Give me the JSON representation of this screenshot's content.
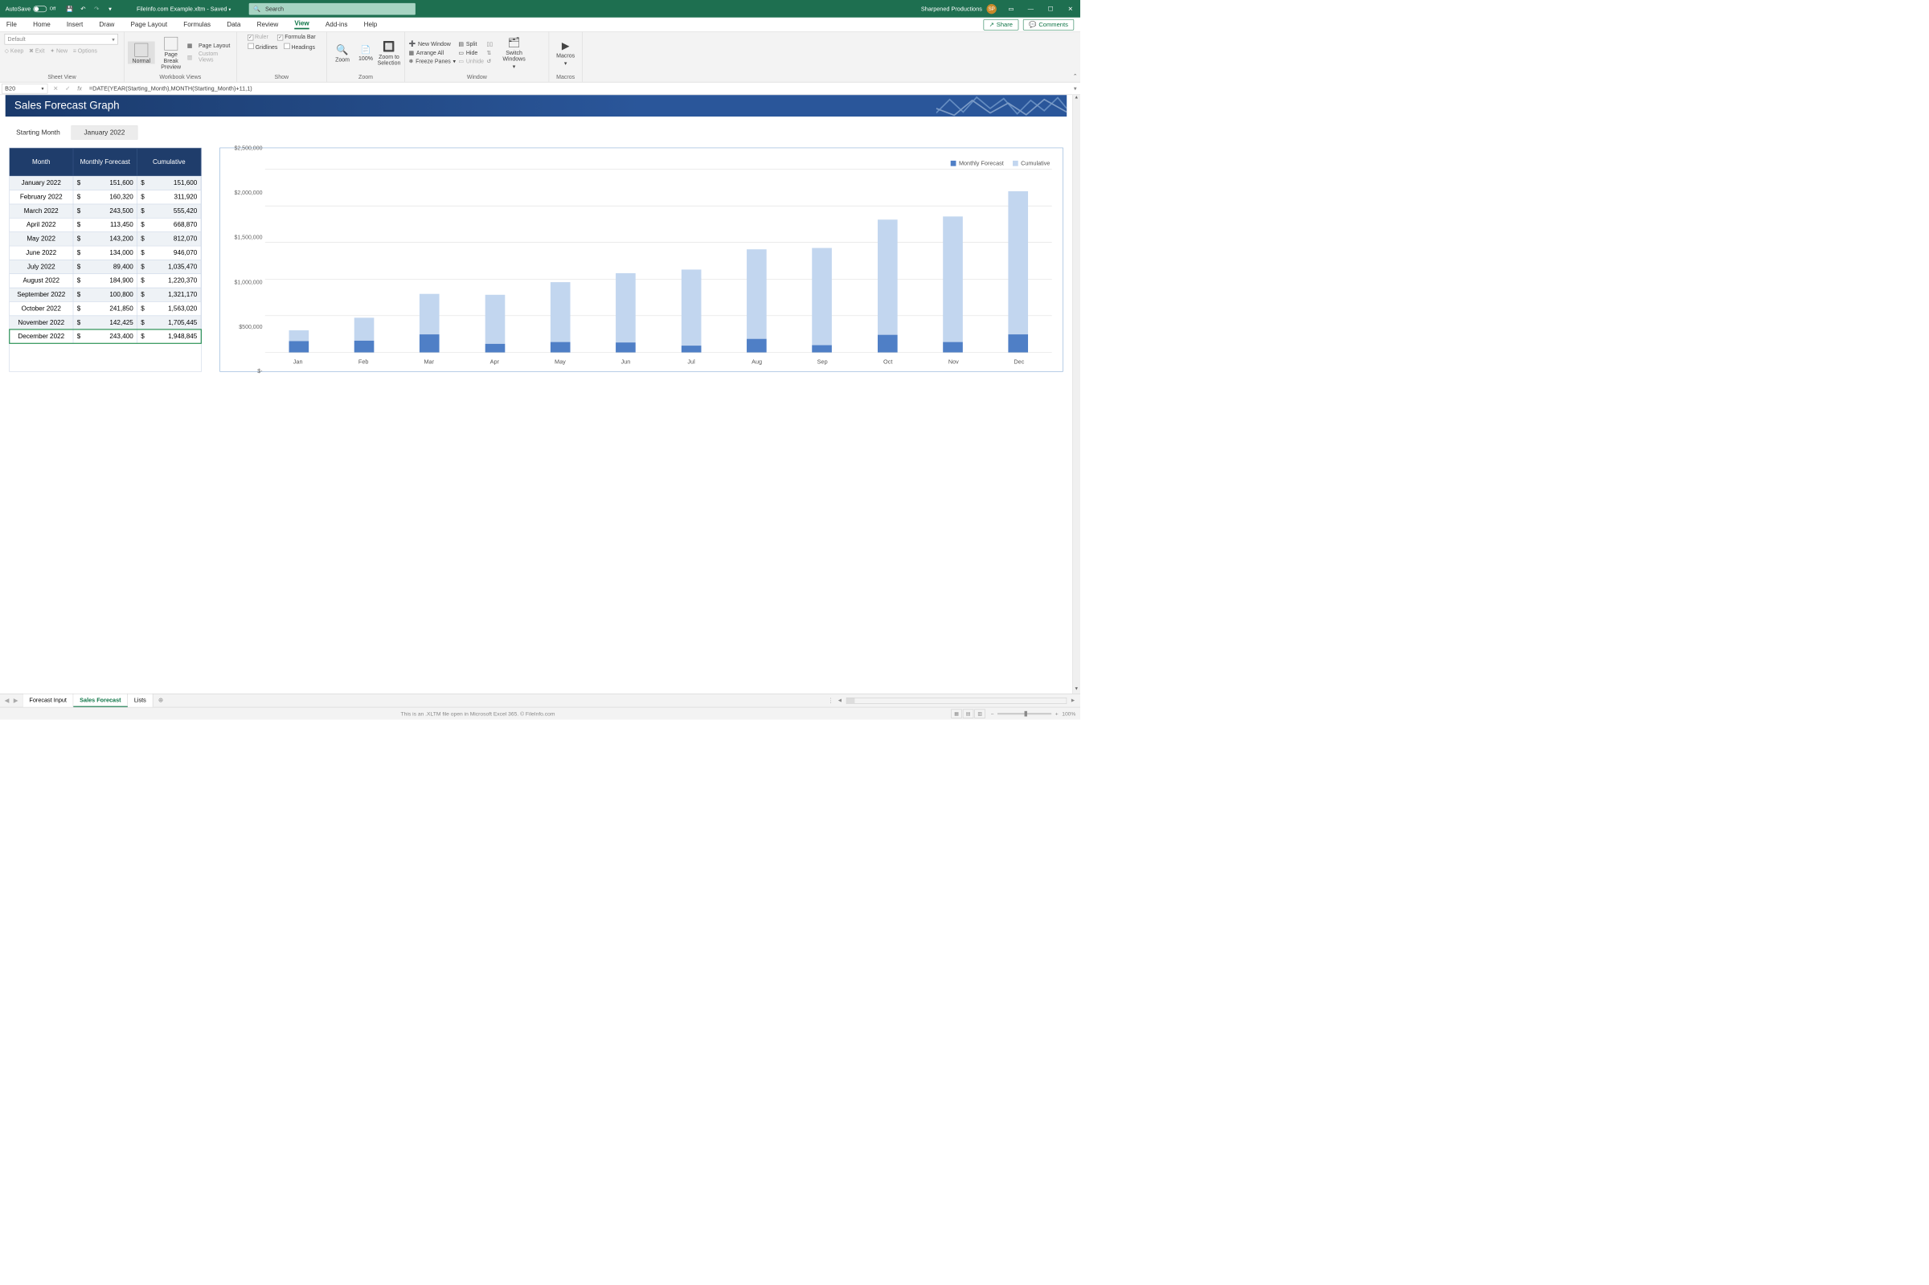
{
  "titlebar": {
    "autosave_label": "AutoSave",
    "autosave_state": "Off",
    "doc_title": "FileInfo.com Example.xltm - Saved",
    "search_placeholder": "Search",
    "account": "Sharpened Productions",
    "account_initials": "SP"
  },
  "ribbon_tabs": [
    "File",
    "Home",
    "Insert",
    "Draw",
    "Page Layout",
    "Formulas",
    "Data",
    "Review",
    "View",
    "Add-ins",
    "Help"
  ],
  "active_tab": "View",
  "share_label": "Share",
  "comments_label": "Comments",
  "ribbon": {
    "sheet_view": {
      "default": "Default",
      "keep": "Keep",
      "exit": "Exit",
      "new": "New",
      "options": "Options",
      "label": "Sheet View"
    },
    "workbook_views": {
      "normal": "Normal",
      "page_break": "Page Break Preview",
      "page_layout": "Page Layout",
      "custom": "Custom Views",
      "label": "Workbook Views"
    },
    "show": {
      "ruler": "Ruler",
      "formula_bar": "Formula Bar",
      "gridlines": "Gridlines",
      "headings": "Headings",
      "label": "Show"
    },
    "zoom": {
      "zoom": "Zoom",
      "hundred": "100%",
      "to_selection": "Zoom to Selection",
      "label": "Zoom"
    },
    "window": {
      "new_window": "New Window",
      "arrange_all": "Arrange All",
      "freeze": "Freeze Panes",
      "split": "Split",
      "hide": "Hide",
      "unhide": "Unhide",
      "switch": "Switch Windows",
      "label": "Window"
    },
    "macros": {
      "macros": "Macros",
      "label": "Macros"
    }
  },
  "formula_bar": {
    "cell_ref": "B20",
    "formula": "=DATE(YEAR(Starting_Month),MONTH(Starting_Month)+11,1)"
  },
  "banner_title": "Sales Forecast Graph",
  "starting_month": {
    "label": "Starting Month",
    "value": "January 2022"
  },
  "table": {
    "headers": [
      "Month",
      "Monthly Forecast",
      "Cumulative"
    ],
    "rows": [
      {
        "month": "January 2022",
        "forecast": "151,600",
        "cumulative": "151,600"
      },
      {
        "month": "February 2022",
        "forecast": "160,320",
        "cumulative": "311,920"
      },
      {
        "month": "March 2022",
        "forecast": "243,500",
        "cumulative": "555,420"
      },
      {
        "month": "April 2022",
        "forecast": "113,450",
        "cumulative": "668,870"
      },
      {
        "month": "May 2022",
        "forecast": "143,200",
        "cumulative": "812,070"
      },
      {
        "month": "June 2022",
        "forecast": "134,000",
        "cumulative": "946,070"
      },
      {
        "month": "July 2022",
        "forecast": "89,400",
        "cumulative": "1,035,470"
      },
      {
        "month": "August 2022",
        "forecast": "184,900",
        "cumulative": "1,220,370"
      },
      {
        "month": "September 2022",
        "forecast": "100,800",
        "cumulative": "1,321,170"
      },
      {
        "month": "October 2022",
        "forecast": "241,850",
        "cumulative": "1,563,020"
      },
      {
        "month": "November 2022",
        "forecast": "142,425",
        "cumulative": "1,705,445"
      },
      {
        "month": "December 2022",
        "forecast": "243,400",
        "cumulative": "1,948,845"
      }
    ],
    "selected_row": 11
  },
  "chart_data": {
    "type": "bar",
    "stacked": true,
    "categories": [
      "Jan",
      "Feb",
      "Mar",
      "Apr",
      "May",
      "Jun",
      "Jul",
      "Aug",
      "Sep",
      "Oct",
      "Nov",
      "Dec"
    ],
    "series": [
      {
        "name": "Monthly Forecast",
        "color": "#4f7fc6",
        "values": [
          151600,
          160320,
          243500,
          113450,
          143200,
          134000,
          89400,
          184900,
          100800,
          241850,
          142425,
          243400
        ]
      },
      {
        "name": "Cumulative",
        "color": "#c2d6ef",
        "values": [
          151600,
          311920,
          555420,
          668870,
          812070,
          946070,
          1035470,
          1220370,
          1321170,
          1563020,
          1705445,
          1948845
        ]
      }
    ],
    "ylim": [
      0,
      2500000
    ],
    "yticks": [
      0,
      500000,
      1000000,
      1500000,
      2000000,
      2500000
    ],
    "ytick_labels": [
      "$-",
      "$500,000",
      "$1,000,000",
      "$1,500,000",
      "$2,000,000",
      "$2,500,000"
    ],
    "legend": [
      "Monthly Forecast",
      "Cumulative"
    ]
  },
  "sheet_tabs": {
    "tabs": [
      "Forecast Input",
      "Sales Forecast",
      "Lists"
    ],
    "active": 1
  },
  "status_bar": {
    "message": "This is an .XLTM file open in Microsoft Excel 365. © FileInfo.com",
    "zoom": "100%"
  }
}
